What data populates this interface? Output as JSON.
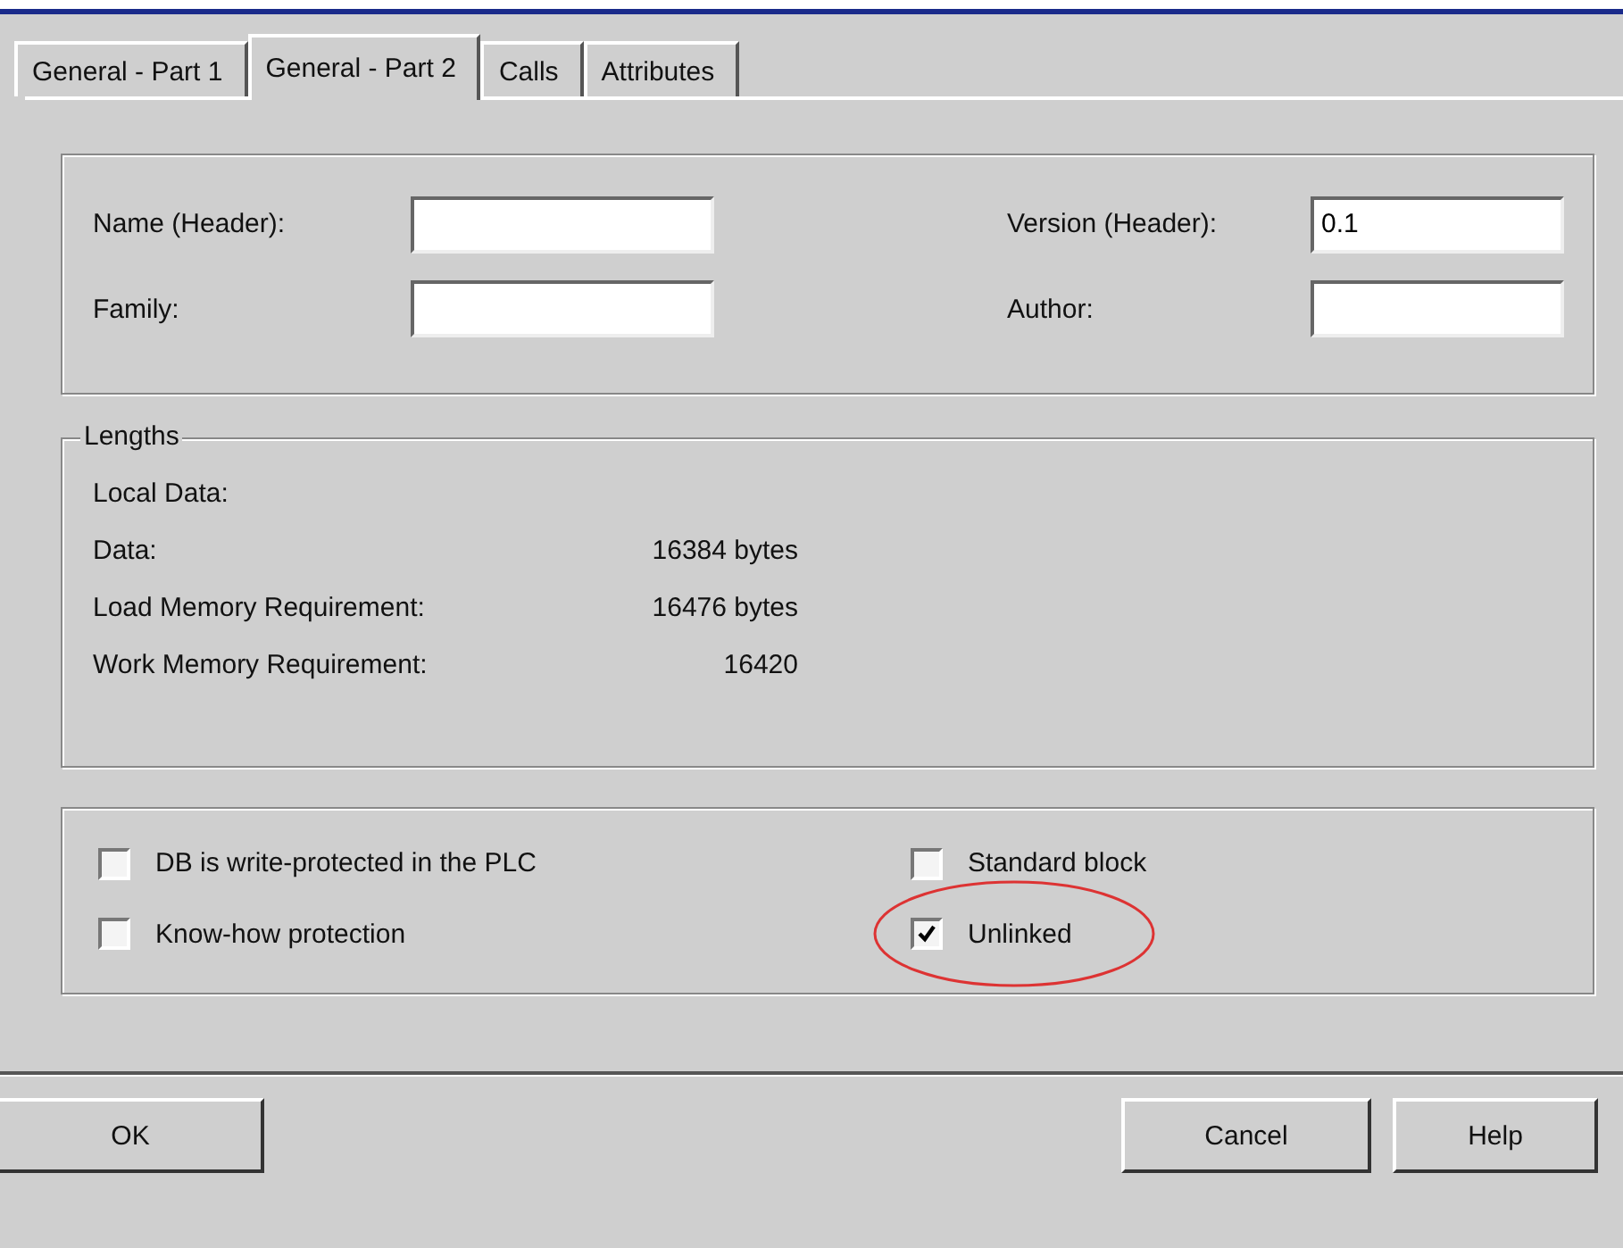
{
  "tabs": [
    {
      "label": "General - Part 1",
      "selected": false
    },
    {
      "label": "General - Part 2",
      "selected": true
    },
    {
      "label": "Calls",
      "selected": false
    },
    {
      "label": "Attributes",
      "selected": false
    }
  ],
  "header_fields": [
    {
      "label": "Name (Header):"
    },
    {
      "label": "Version (Header):",
      "value": "0.1"
    },
    {
      "label": "Family:"
    },
    {
      "label": "Author:"
    }
  ],
  "lengths": {
    "title": "Lengths",
    "rows": [
      {
        "label": "Local Data:"
      },
      {
        "label": "Data:",
        "value": "16384 bytes"
      },
      {
        "label": "Load Memory Requirement:",
        "value": "16476 bytes"
      },
      {
        "label": "Work Memory Requirement:",
        "value": "16420"
      }
    ]
  },
  "options": [
    {
      "label": "DB is write-protected in the PLC",
      "checked": false,
      "highlighted": false
    },
    {
      "label": "Standard block",
      "checked": false,
      "highlighted": false
    },
    {
      "label": "Know-how protection",
      "checked": false,
      "highlighted": false
    },
    {
      "label": "Unlinked",
      "checked": true,
      "highlighted": true
    }
  ],
  "buttons": [
    "OK",
    "Cancel",
    "Help"
  ]
}
